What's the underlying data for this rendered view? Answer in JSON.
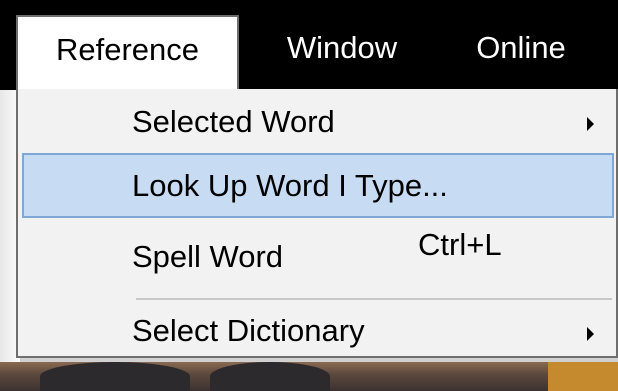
{
  "menubar": {
    "items": [
      {
        "label": "Reference"
      },
      {
        "label": "Window"
      },
      {
        "label": "Online"
      }
    ]
  },
  "dropdown": {
    "items": [
      {
        "label": "Selected Word",
        "shortcut": "",
        "has_submenu": true
      },
      {
        "label": "Look Up Word I Type...",
        "shortcut": "",
        "has_submenu": false,
        "highlighted": true
      },
      {
        "label": "Spell Word",
        "shortcut": "Ctrl+L",
        "has_submenu": false
      },
      {
        "label": "Select Dictionary",
        "shortcut": "",
        "has_submenu": true
      }
    ]
  },
  "colors": {
    "menubar_bg": "#000000",
    "highlight_bg": "#c7dcf3",
    "highlight_border": "#7fa7d6",
    "menu_bg": "#f2f2f2"
  }
}
